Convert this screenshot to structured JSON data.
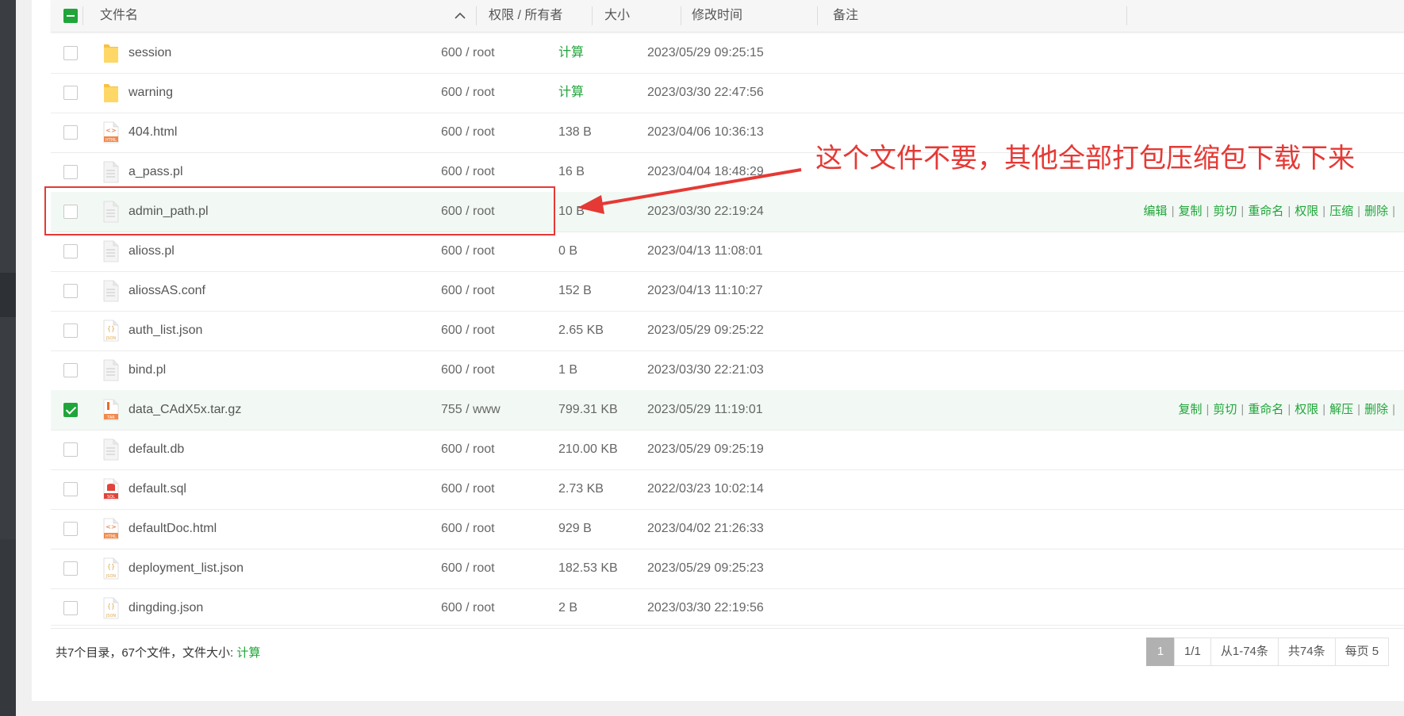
{
  "header": {
    "col_name": "文件名",
    "col_perm": "权限 / 所有者",
    "col_size": "大小",
    "col_time": "修改时间",
    "col_note": "备注"
  },
  "rows": [
    {
      "name": "session",
      "perm": "600 / root",
      "size": "计算",
      "size_is_link": true,
      "time": "2023/05/29 09:25:15",
      "type": "folder",
      "checked": false,
      "hover": false
    },
    {
      "name": "warning",
      "perm": "600 / root",
      "size": "计算",
      "size_is_link": true,
      "time": "2023/03/30 22:47:56",
      "type": "folder",
      "checked": false,
      "hover": false
    },
    {
      "name": "404.html",
      "perm": "600 / root",
      "size": "138 B",
      "time": "2023/04/06 10:36:13",
      "type": "html",
      "checked": false,
      "hover": false
    },
    {
      "name": "a_pass.pl",
      "perm": "600 / root",
      "size": "16 B",
      "time": "2023/04/04 18:48:29",
      "type": "text",
      "checked": false,
      "hover": false
    },
    {
      "name": "admin_path.pl",
      "perm": "600 / root",
      "size": "10 B",
      "time": "2023/03/30 22:19:24",
      "type": "text",
      "checked": false,
      "hover": true,
      "ops": [
        "编辑",
        "复制",
        "剪切",
        "重命名",
        "权限",
        "压缩",
        "删除"
      ]
    },
    {
      "name": "alioss.pl",
      "perm": "600 / root",
      "size": "0 B",
      "time": "2023/04/13 11:08:01",
      "type": "text",
      "checked": false,
      "hover": false
    },
    {
      "name": "aliossAS.conf",
      "perm": "600 / root",
      "size": "152 B",
      "time": "2023/04/13 11:10:27",
      "type": "text",
      "checked": false,
      "hover": false
    },
    {
      "name": "auth_list.json",
      "perm": "600 / root",
      "size": "2.65 KB",
      "time": "2023/05/29 09:25:22",
      "type": "json",
      "checked": false,
      "hover": false
    },
    {
      "name": "bind.pl",
      "perm": "600 / root",
      "size": "1 B",
      "time": "2023/03/30 22:21:03",
      "type": "text",
      "checked": false,
      "hover": false
    },
    {
      "name": "data_CAdX5x.tar.gz",
      "perm": "755 / www",
      "size": "799.31 KB",
      "time": "2023/05/29 11:19:01",
      "type": "tar",
      "checked": true,
      "hover": true,
      "ops": [
        "复制",
        "剪切",
        "重命名",
        "权限",
        "解压",
        "删除"
      ]
    },
    {
      "name": "default.db",
      "perm": "600 / root",
      "size": "210.00 KB",
      "time": "2023/05/29 09:25:19",
      "type": "text",
      "checked": false,
      "hover": false
    },
    {
      "name": "default.sql",
      "perm": "600 / root",
      "size": "2.73 KB",
      "time": "2022/03/23 10:02:14",
      "type": "sql",
      "checked": false,
      "hover": false
    },
    {
      "name": "defaultDoc.html",
      "perm": "600 / root",
      "size": "929 B",
      "time": "2023/04/02 21:26:33",
      "type": "html",
      "checked": false,
      "hover": false
    },
    {
      "name": "deployment_list.json",
      "perm": "600 / root",
      "size": "182.53 KB",
      "time": "2023/05/29 09:25:23",
      "type": "json",
      "checked": false,
      "hover": false
    },
    {
      "name": "dingding.json",
      "perm": "600 / root",
      "size": "2 B",
      "time": "2023/03/30 22:19:56",
      "type": "json",
      "checked": false,
      "hover": false
    }
  ],
  "icon_labels": {
    "html": "HTML",
    "json": "JSON",
    "tar": "TAR",
    "sql": "SQL"
  },
  "annotation": {
    "text": "这个文件不要，其他全部打包压缩包下载下来"
  },
  "footer": {
    "summary": "共7个目录，67个文件，文件大小:",
    "calc_link": "计算"
  },
  "pager": {
    "current": "1",
    "pages": "1/1",
    "range": "从1-74条",
    "total": "共74条",
    "per_page": "每页 5"
  },
  "colors": {
    "accent": "#20a53a",
    "annotation": "#e53935"
  }
}
